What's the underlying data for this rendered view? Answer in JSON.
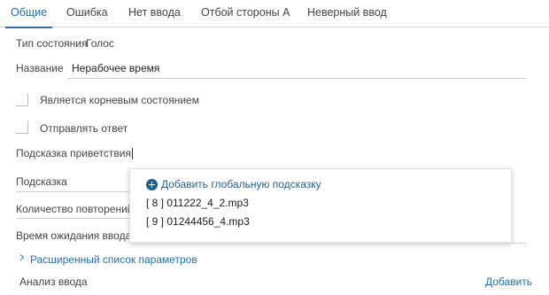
{
  "tabs": [
    {
      "label": "Общие",
      "active": true
    },
    {
      "label": "Ошибка",
      "active": false
    },
    {
      "label": "Нет ввода",
      "active": false
    },
    {
      "label": "Отбой стороны А",
      "active": false
    },
    {
      "label": "Неверный ввод",
      "active": false
    }
  ],
  "form": {
    "state_type_label": "Тип состояния",
    "state_type_value": "Голос",
    "name_label": "Название",
    "name_value": "Нерабочее время",
    "root_state_label": "Является корневым состоянием",
    "send_answer_label": "Отправлять ответ",
    "greeting_prompt_label": "Подсказка приветствия",
    "prompt_label": "Подсказка",
    "repeat_count_label": "Количество повторений",
    "input_wait_label": "Время ожидания ввода п"
  },
  "dropdown": {
    "add_global_label": "Добавить глобальную подсказку",
    "items": [
      "[ 8 ] 011222_4_2.mp3",
      "[ 9 ] 01244456_4.mp3"
    ]
  },
  "advanced_link": "Расширенный список параметров",
  "input_analysis_label": "Анализ ввода",
  "add_link": "Добавить",
  "colors": {
    "accent": "#1f6fb2",
    "dropdown_accent": "#1f5f8f"
  },
  "icons": [
    "plus-circle-icon",
    "chevron-right-icon"
  ]
}
